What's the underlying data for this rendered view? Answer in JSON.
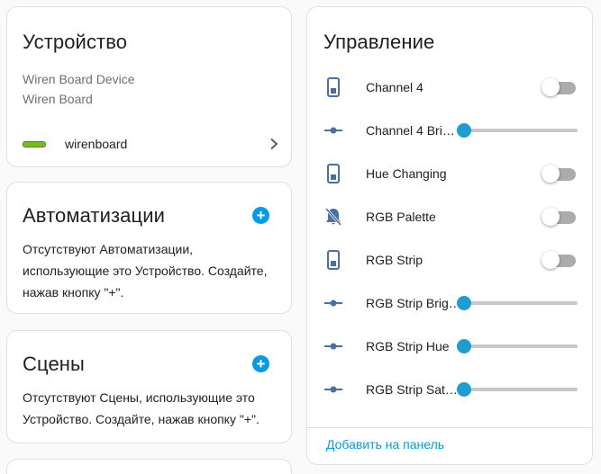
{
  "device": {
    "title": "Устройство",
    "model": "Wiren Board Device",
    "manufacturer": "Wiren Board",
    "integration": "wirenboard"
  },
  "automations": {
    "title": "Автоматизации",
    "body": "Отсутствуют Автоматизации, использующие это Устройство. Создайте, нажав кнопку \"+\"."
  },
  "scenes": {
    "title": "Сцены",
    "body": "Отсутствуют Сцены, использующие это Устройство. Создайте, нажав кнопку \"+\"."
  },
  "control": {
    "title": "Управление",
    "add_to_panel": "Добавить на панель",
    "entities": [
      {
        "label": "Channel 4",
        "kind": "toggle",
        "icon": "switch-icon",
        "on": false
      },
      {
        "label": "Channel 4 Bri…",
        "kind": "slider",
        "icon": "slider-icon",
        "value": 0
      },
      {
        "label": "Hue Changing",
        "kind": "toggle",
        "icon": "switch-icon",
        "on": false
      },
      {
        "label": "RGB Palette",
        "kind": "toggle",
        "icon": "bell-off-icon",
        "on": false
      },
      {
        "label": "RGB Strip",
        "kind": "toggle",
        "icon": "switch-icon",
        "on": false
      },
      {
        "label": "RGB Strip Brig…",
        "kind": "slider",
        "icon": "slider-icon",
        "value": 0
      },
      {
        "label": "RGB Strip Hue",
        "kind": "slider",
        "icon": "slider-icon",
        "value": 0
      },
      {
        "label": "RGB Strip Sat…",
        "kind": "slider",
        "icon": "slider-icon",
        "value": 0
      }
    ]
  },
  "colors": {
    "accent": "#039be5",
    "icon": "#4a6fa0",
    "toggle_off": "#9e9e9e"
  }
}
